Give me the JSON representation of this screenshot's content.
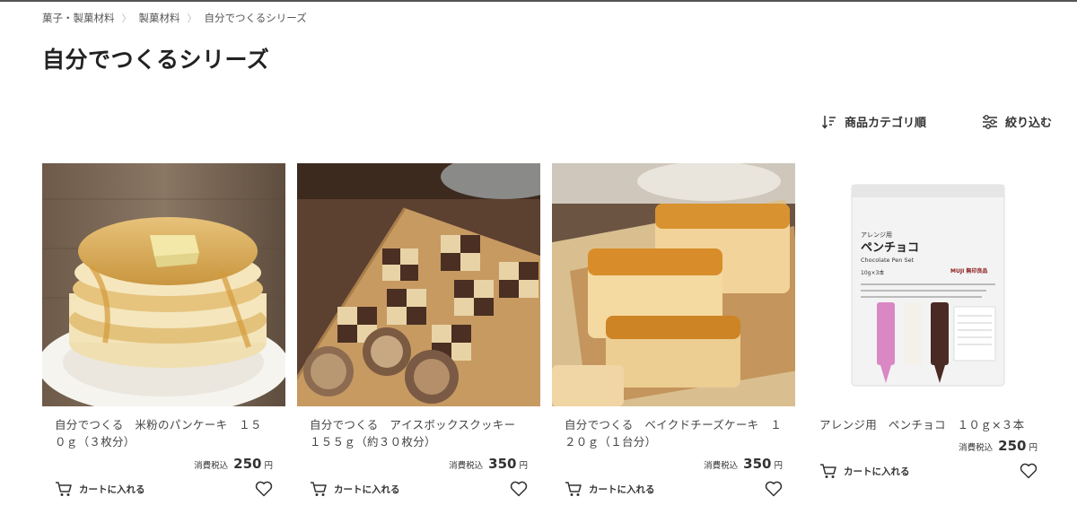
{
  "breadcrumb": [
    {
      "label": "菓子・製菓材料"
    },
    {
      "label": "製菓材料"
    },
    {
      "label": "自分でつくるシリーズ"
    }
  ],
  "page_title": "自分でつくるシリーズ",
  "toolbar": {
    "sort_label": "商品カテゴリ順",
    "filter_label": "絞り込む"
  },
  "products": [
    {
      "name": "自分でつくる　米粉のパンケーキ　１５０ｇ（３枚分）",
      "tax_label": "消費税込",
      "price": "250",
      "currency": "円",
      "cart_label": "カートに入れる",
      "image": "pancake-stack-photo"
    },
    {
      "name": "自分でつくる　アイスボックスクッキー　１５５ｇ（約３０枚分）",
      "tax_label": "消費税込",
      "price": "350",
      "currency": "円",
      "cart_label": "カートに入れる",
      "image": "icebox-cookies-photo"
    },
    {
      "name": "自分でつくる　ベイクドチーズケーキ　１２０ｇ（１台分）",
      "tax_label": "消費税込",
      "price": "350",
      "currency": "円",
      "cart_label": "カートに入れる",
      "image": "baked-cheesecake-photo"
    },
    {
      "name": "アレンジ用　ペンチョコ　１０ｇ×３本",
      "tax_label": "消費税込",
      "price": "250",
      "currency": "円",
      "cart_label": "カートに入れる",
      "image": "chocolate-pen-package-photo",
      "package": {
        "line1": "アレンジ用",
        "line2": "ペンチョコ",
        "line3": "Chocolate Pen Set",
        "line4": "10g×3本",
        "brand": "MUJI 無印良品"
      }
    }
  ],
  "icons": {
    "sort": "sort-order-icon",
    "filter": "filter-sliders-icon",
    "cart": "cart-icon",
    "favorite": "heart-outline-icon"
  }
}
